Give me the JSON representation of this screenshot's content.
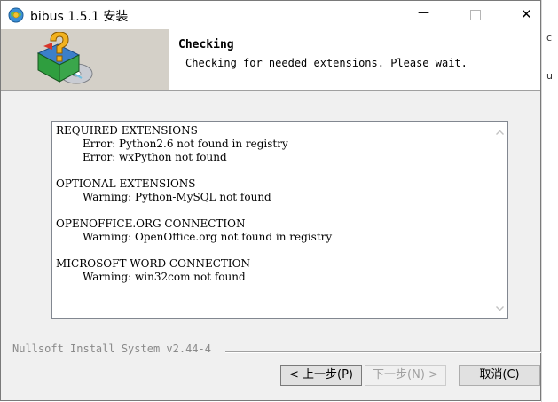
{
  "window": {
    "title": "bibus 1.5.1 安装",
    "minimize_glyph": "—",
    "close_glyph": "✕"
  },
  "header": {
    "title": "Checking",
    "subtitle": "Checking for needed extensions. Please wait."
  },
  "log": {
    "lines": [
      {
        "text": "REQUIRED EXTENSIONS",
        "indent": false
      },
      {
        "text": "Error: Python2.6 not found in registry",
        "indent": true
      },
      {
        "text": "Error: wxPython not found",
        "indent": true
      },
      {
        "text": "",
        "indent": false
      },
      {
        "text": "OPTIONAL EXTENSIONS",
        "indent": false
      },
      {
        "text": "Warning: Python-MySQL not found",
        "indent": true
      },
      {
        "text": "",
        "indent": false
      },
      {
        "text": "OPENOFFICE.ORG CONNECTION",
        "indent": false
      },
      {
        "text": "Warning: OpenOffice.org not found in registry",
        "indent": true
      },
      {
        "text": "",
        "indent": false
      },
      {
        "text": "MICROSOFT WORD CONNECTION",
        "indent": false
      },
      {
        "text": "Warning: win32com not found",
        "indent": true
      }
    ]
  },
  "footer": {
    "brand": "Nullsoft Install System v2.44-4",
    "back_label": "< 上一步(P)",
    "next_label": "下一步(N) >",
    "cancel_label": "取消(C)"
  },
  "desktop": {
    "glyph_top": "c",
    "glyph_bottom": "u"
  },
  "icons": {
    "app": "installer-globe-icon",
    "header_art": "box-question-cd-icon"
  }
}
